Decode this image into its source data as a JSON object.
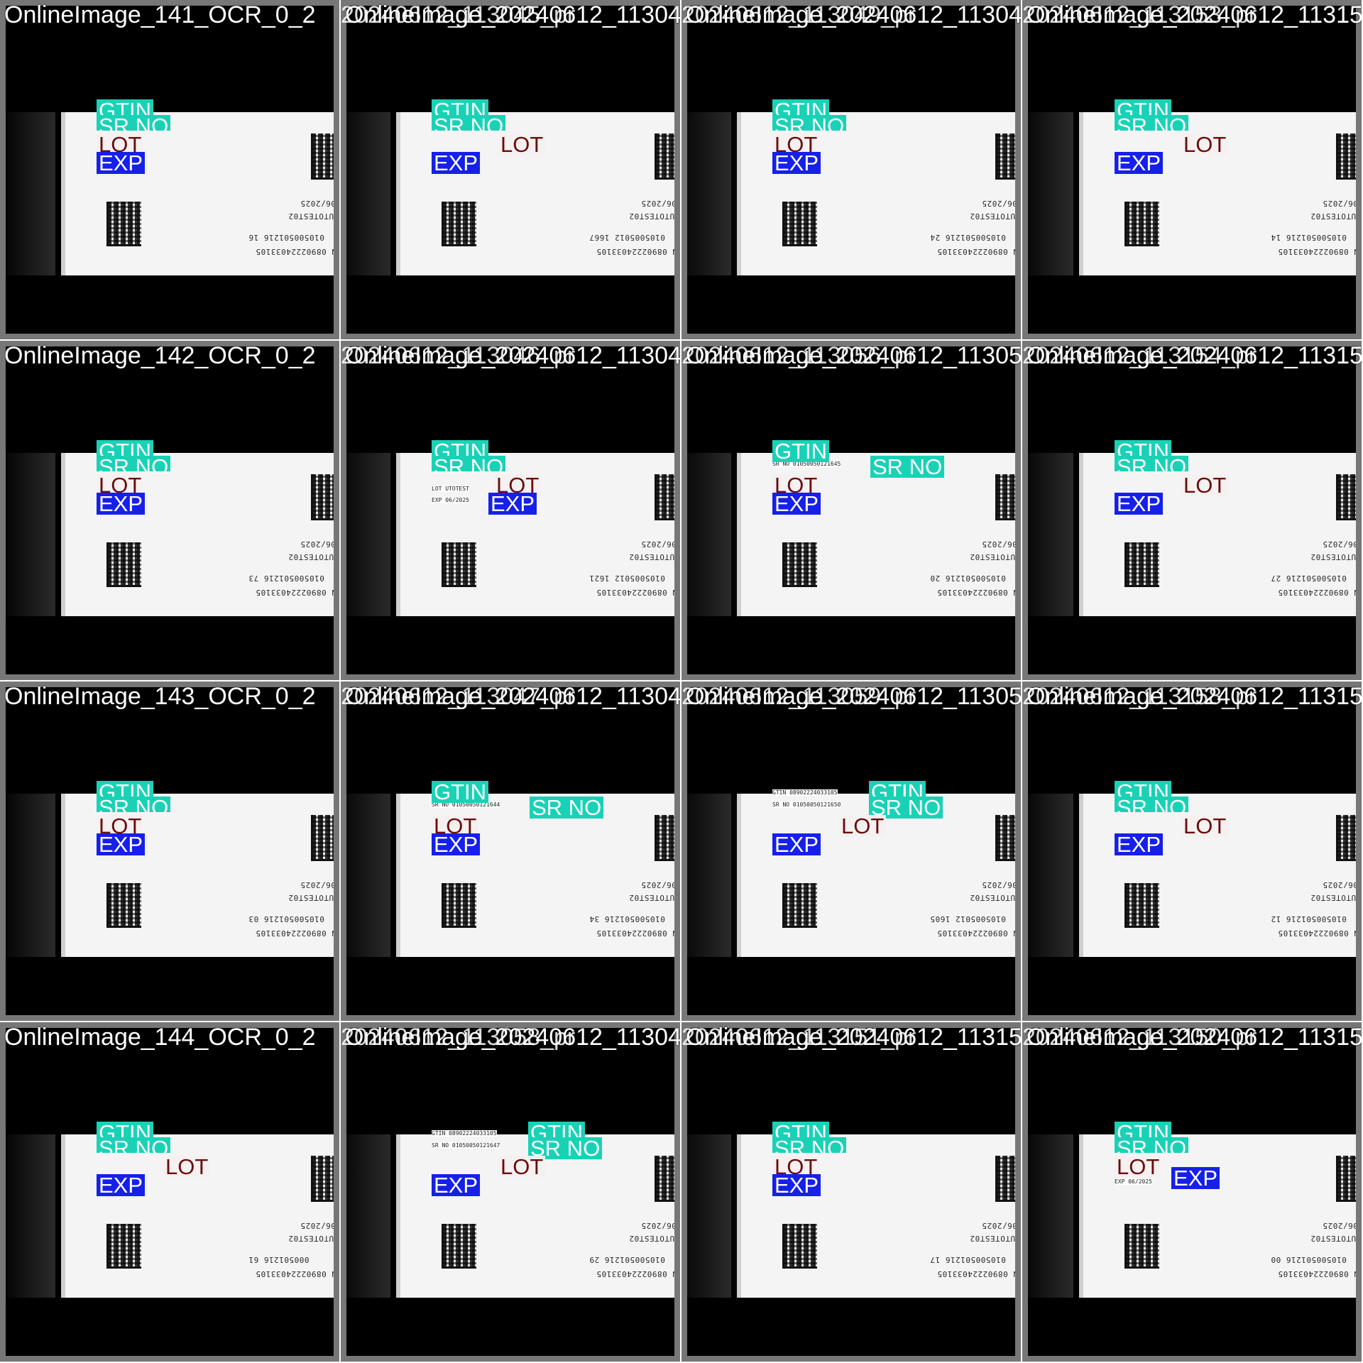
{
  "tiles": [
    {
      "caption": "OnlineImage_141_OCR_0_2",
      "overlap": "20240612_113045_pr",
      "layout": "a",
      "lot_pos": "left",
      "exp_pos": "under",
      "serial": "010500501216 16",
      "lot_text": "UTOTEST02",
      "exp_text": "06/2025",
      "gtin_text": "N 08902224033105"
    },
    {
      "caption": "OnlineImage_20240612_113045_OCR_0_",
      "overlap": "20240612_113045_pr",
      "layout": "b",
      "lot_pos": "right",
      "exp_pos": "under",
      "serial": "0105005012 1667",
      "lot_text": "UTOTEST02",
      "exp_text": "06/2025",
      "gtin_text": "N 08902224033105"
    },
    {
      "caption": "OnlineImage_20240612_113049_OCR_0_",
      "overlap": "20240612_113049_pr",
      "layout": "a",
      "lot_pos": "left",
      "exp_pos": "under",
      "serial": "010500501216 24",
      "lot_text": "UTOTEST02",
      "exp_text": "06/2025",
      "gtin_text": "N 08902224033105"
    },
    {
      "caption": "OnlineImage_20240612_113153_OCR_0_2",
      "overlap": "20240612_113153_pr",
      "layout": "b",
      "lot_pos": "right",
      "exp_pos": "under",
      "serial": "010500501216 14",
      "lot_text": "UTOTEST02",
      "exp_text": "06/2025",
      "gtin_text": "N 08902224033105"
    },
    {
      "caption": "OnlineImage_142_OCR_0_2",
      "overlap": "20240612_113046_pr",
      "layout": "a",
      "lot_pos": "left",
      "exp_pos": "under",
      "serial": "010500501216 73",
      "lot_text": "UTOTEST02",
      "exp_text": "06/2025",
      "gtin_text": "N 08902224033105"
    },
    {
      "caption": "OnlineImage_20240612_113046_OCR_0_",
      "overlap": "20240612_113046_pr",
      "layout": "c",
      "lot_pos": "right",
      "exp_pos": "right",
      "serial": "0105005012 1621",
      "lot_text": "UTOTEST02",
      "exp_text": "06/2025",
      "gtin_text": "N 08902224033105",
      "inline_lot": "LOT UTOTEST",
      "inline_exp": "EXP 06/2025"
    },
    {
      "caption": "OnlineImage_20240612_113056_OCR_0_",
      "overlap": "20240612_113056_pr",
      "layout": "d",
      "lot_pos": "left",
      "exp_pos": "under",
      "serial": "010500501216 20",
      "lot_text": "UTOTEST02",
      "exp_text": "06/2025",
      "gtin_text": "N 08902224033105",
      "gtin_value": "033105",
      "sr_value": "SR NO 01050050121645"
    },
    {
      "caption": "OnlineImage_20240612_113154_OCR_0_2",
      "overlap": "20240612_113154_pr",
      "layout": "b",
      "lot_pos": "right",
      "exp_pos": "under",
      "serial": "010500501216 27",
      "lot_text": "UTOTEST02",
      "exp_text": "06/2025",
      "gtin_text": "N 08902224033105"
    },
    {
      "caption": "OnlineImage_143_OCR_0_2",
      "overlap": "20240612_113047_pr",
      "layout": "a",
      "lot_pos": "left",
      "exp_pos": "under",
      "serial": "010500501216 03",
      "lot_text": "UTOTEST02",
      "exp_text": "06/2025",
      "gtin_text": "N 08902224033105"
    },
    {
      "caption": "OnlineImage_20240612_113047_OCR_0_",
      "overlap": "20240612_113047_pr",
      "layout": "d",
      "lot_pos": "left",
      "exp_pos": "under",
      "serial": "010500501216 34",
      "lot_text": "UTOTEST02",
      "exp_text": "06/2025",
      "gtin_text": "N 08902224033105",
      "gtin_value": "033105",
      "sr_value": "SR NO 01050050121644"
    },
    {
      "caption": "OnlineImage_20240612_113059_OCR_0_",
      "overlap": "20240612_113059_pr",
      "layout": "e",
      "lot_pos": "right",
      "exp_pos": "under",
      "serial": "0105005012 1605",
      "lot_text": "UTOTEST02",
      "exp_text": "06/2025",
      "gtin_text": "N 08902224033105",
      "gtin_value": "GTIN 08902224033105",
      "sr_value": "SR NO 01050050121650"
    },
    {
      "caption": "OnlineImage_20240612_113158_OCR_0_2",
      "overlap": "20240612_113158_pr",
      "layout": "b",
      "lot_pos": "right",
      "exp_pos": "under",
      "serial": "010500501216 12",
      "lot_text": "UTOTEST02",
      "exp_text": "06/2025",
      "gtin_text": "N 08902224033105"
    },
    {
      "caption": "OnlineImage_144_OCR_0_2",
      "overlap": "20240612_113048_pr",
      "layout": "b",
      "lot_pos": "right",
      "exp_pos": "under",
      "serial": "000501216 61",
      "lot_text": "UTOTEST02",
      "exp_text": "06/2025",
      "gtin_text": "N 08902224033105"
    },
    {
      "caption": "OnlineImage_20240612_113048_OCR_0_",
      "overlap": "20240612_113058_pr",
      "layout": "e",
      "lot_pos": "right",
      "exp_pos": "under",
      "serial": "010500501216 29",
      "lot_text": "UTOTEST02",
      "exp_text": "06/2025",
      "gtin_text": "N 08902224033105",
      "gtin_value": "GTIN 08902224033105",
      "sr_value": "SR NO 01050050121647"
    },
    {
      "caption": "OnlineImage_20240612_113152_OCR_0_",
      "overlap": "20240612_113151_pr",
      "layout": "a",
      "lot_pos": "left",
      "exp_pos": "under",
      "serial": "010500501216 17",
      "lot_text": "UTOTEST02",
      "exp_text": "06/2025",
      "gtin_text": "N 08902224033105"
    },
    {
      "caption": "OnlineImage_20240612_113156_OCR_0_2",
      "overlap": "20240612_113150_pr",
      "layout": "f",
      "lot_pos": "left",
      "exp_pos": "right",
      "serial": "010500501216 00",
      "lot_text": "UTOTEST02",
      "exp_text": "06/2025",
      "gtin_text": "N 08902224033105",
      "inline_exp": "EXP 06/2025"
    }
  ],
  "labels": {
    "gtin": "GTIN",
    "srno": "SR NO",
    "lot": "LOT",
    "exp": "EXP"
  },
  "colors": {
    "gtin": "#19d2b6",
    "srno": "#19d2b6",
    "lot_bg": "#f5f0f0",
    "lot_text": "#6b0c0c",
    "exp": "#1620e8"
  }
}
